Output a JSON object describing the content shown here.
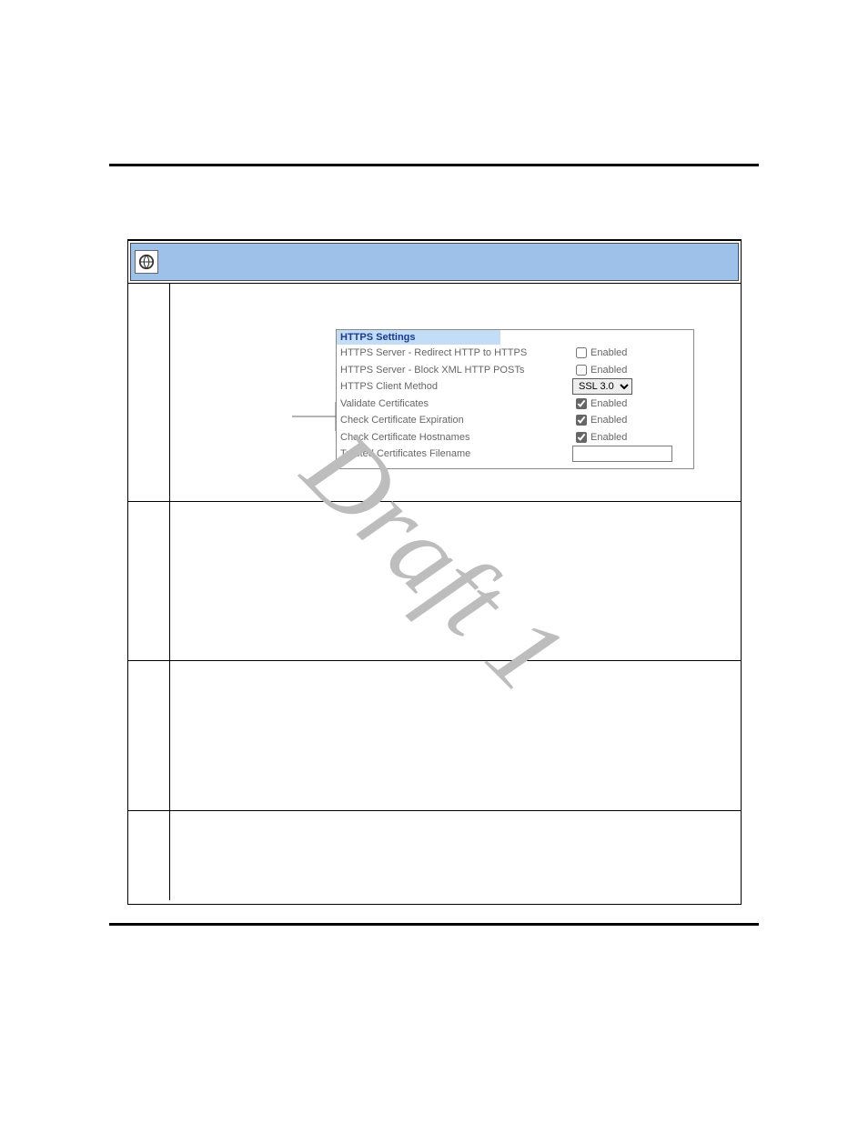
{
  "settings_panel": {
    "title": "HTTPS Settings",
    "rows": [
      {
        "label": "HTTPS Server - Redirect HTTP to HTTPS",
        "control": "checkbox",
        "text": "Enabled",
        "checked": false
      },
      {
        "label": "HTTPS Server - Block XML HTTP POSTs",
        "control": "checkbox",
        "text": "Enabled",
        "checked": false
      },
      {
        "label": "HTTPS Client Method",
        "control": "select",
        "value": "SSL 3.0"
      },
      {
        "label": "Validate Certificates",
        "control": "checkbox",
        "text": "Enabled",
        "checked": true
      },
      {
        "label": "Check Certificate Expiration",
        "control": "checkbox",
        "text": "Enabled",
        "checked": true
      },
      {
        "label": "Check Certificate Hostnames",
        "control": "checkbox",
        "text": "Enabled",
        "checked": true
      },
      {
        "label": "Trusted Certificates Filename",
        "control": "text",
        "value": ""
      }
    ]
  },
  "watermark": "Draft 1"
}
